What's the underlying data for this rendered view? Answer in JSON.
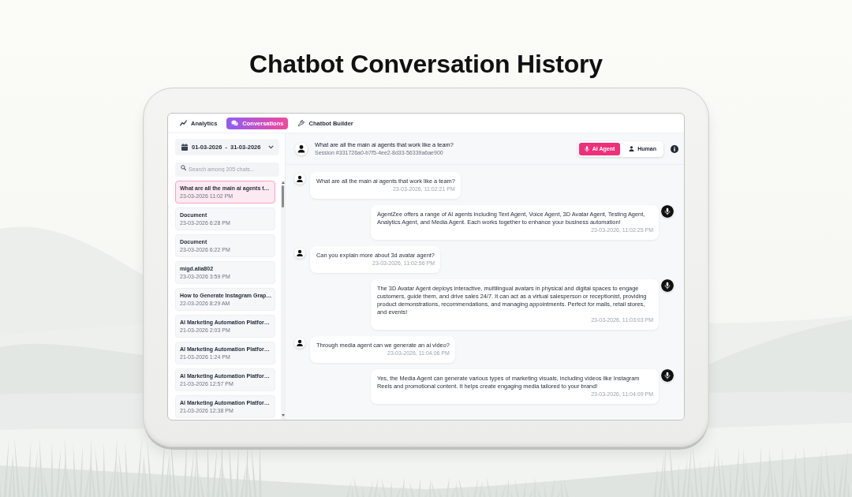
{
  "page": {
    "title": "Chatbot Conversation History"
  },
  "tabs": [
    {
      "label": "Analytics",
      "selected": false
    },
    {
      "label": "Conversations",
      "selected": true
    },
    {
      "label": "Chatbot Builder",
      "selected": false
    }
  ],
  "sidebar": {
    "date_range": "01-03-2026 - 31-03-2026",
    "search": {
      "placeholder": "Search among 205 chats..."
    },
    "conversations": [
      {
        "title": "What are all the main ai agents t…",
        "time": "23-03-2026 11:02 PM",
        "selected": true
      },
      {
        "title": "Document",
        "time": "23-03-2026 6:28 PM",
        "selected": false
      },
      {
        "title": "Document",
        "time": "23-03-2026 6:22 PM",
        "selected": false
      },
      {
        "title": "migd.alia802",
        "time": "23-03-2026 3:59 PM",
        "selected": false
      },
      {
        "title": "How to Generate Instagram Grap…",
        "time": "22-03-2026 8:29 AM",
        "selected": false
      },
      {
        "title": "AI Marketing Automation Platfor…",
        "time": "21-03-2026 2:03 PM",
        "selected": false
      },
      {
        "title": "AI Marketing Automation Platfor…",
        "time": "21-03-2026 1:24 PM",
        "selected": false
      },
      {
        "title": "AI Marketing Automation Platfor…",
        "time": "21-03-2026 12:57 PM",
        "selected": false
      },
      {
        "title": "AI Marketing Automation Platfor…",
        "time": "21-03-2026 12:38 PM",
        "selected": false
      }
    ]
  },
  "chat": {
    "title": "What are all the main ai agents that work like a team?",
    "session": "Session #331726a0-b7f5-4ee2-8d33-56339a6ae900",
    "modes": [
      {
        "label": "AI Agent",
        "selected": true
      },
      {
        "label": "Human",
        "selected": false
      }
    ],
    "messages": [
      {
        "kind": "user",
        "text": "What are all the main ai agents that work like a team?",
        "time": "23-03-2026, 11:02:21 PM"
      },
      {
        "kind": "agent",
        "text": "AgentZee offers a range of AI agents including Text Agent, Voice Agent, 3D Avatar Agent, Testing Agent, Analytics Agent, and Media Agent. Each works together to enhance your business automation!",
        "time": "23-03-2026, 11:02:25 PM"
      },
      {
        "kind": "user",
        "text": "Can you explain more about 3d avatar agent?",
        "time": "23-03-2026, 11:02:56 PM"
      },
      {
        "kind": "agent",
        "text": "The 3D Avatar Agent deploys interactive, multilingual avatars in physical and digital spaces to engage customers, guide them, and drive sales 24/7. It can act as a virtual salesperson or receptionist, providing product demonstrations, recommendations, and managing appointments. Perfect for malls, retail stores, and events!",
        "time": "23-03-2026, 11:03:03 PM"
      },
      {
        "kind": "user",
        "text": "Through media agent can we generate an ai video?",
        "time": "23-03-2026, 11:04:06 PM"
      },
      {
        "kind": "agent",
        "text": "Yes, the Media Agent can generate various types of marketing visuals, including videos like Instagram Reels and promotional content. It helps create engaging media tailored to your brand!",
        "time": "23-03-2026, 11:04:09 PM"
      }
    ]
  }
}
